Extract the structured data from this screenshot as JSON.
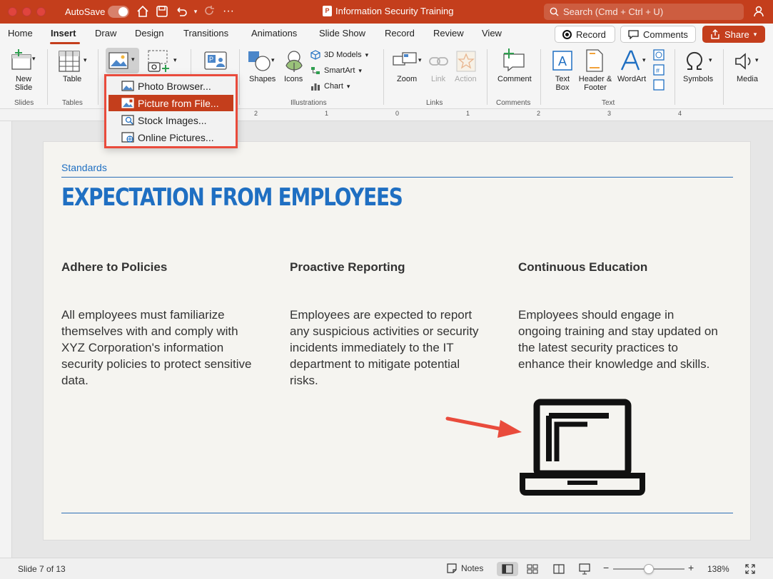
{
  "window": {
    "autosave_label": "AutoSave",
    "title": "Information Security Training",
    "search_placeholder": "Search (Cmd + Ctrl + U)"
  },
  "tabs": [
    "Home",
    "Insert",
    "Draw",
    "Design",
    "Transitions",
    "Animations",
    "Slide Show",
    "Record",
    "Review",
    "View"
  ],
  "tab_actions": {
    "record": "Record",
    "comments": "Comments",
    "share": "Share"
  },
  "ribbon": {
    "new_slide": [
      "New",
      "Slide"
    ],
    "table": "Table",
    "shapes": "Shapes",
    "icons": "Icons",
    "models_3d": "3D Models",
    "smartart": "SmartArt",
    "chart": "Chart",
    "zoom": "Zoom",
    "link": "Link",
    "action": "Action",
    "comment": "Comment",
    "text_box": [
      "Text",
      "Box"
    ],
    "header_footer": [
      "Header &",
      "Footer"
    ],
    "wordart": "WordArt",
    "symbols": "Symbols",
    "media": "Media",
    "groups": [
      "Slides",
      "Tables",
      "Illustrations",
      "Links",
      "Comments",
      "Text"
    ]
  },
  "picture_menu": [
    {
      "label": "Photo Browser...",
      "icon": "photo-browser-icon",
      "highlighted": false
    },
    {
      "label": "Picture from File...",
      "icon": "picture-from-file-icon",
      "highlighted": true
    },
    {
      "label": "Stock Images...",
      "icon": "stock-images-icon",
      "highlighted": false
    },
    {
      "label": "Online Pictures...",
      "icon": "online-pictures-icon",
      "highlighted": false
    }
  ],
  "ruler": {
    "ticks": [
      "3",
      "2",
      "1",
      "0",
      "1",
      "2",
      "3",
      "4"
    ]
  },
  "slide": {
    "eyebrow": "Standards",
    "title": "EXPECTATION FROM EMPLOYEES",
    "columns": [
      {
        "heading": "Adhere to Policies",
        "body": "All employees must familiarize themselves with and comply with XYZ Corporation's information security policies to protect sensitive data."
      },
      {
        "heading": "Proactive Reporting",
        "body": "Employees are expected to report any suspicious activities or security incidents immediately to the IT department to mitigate potential risks."
      },
      {
        "heading": "Continuous Education",
        "body": "Employees should engage in ongoing training and stay updated on the latest security practices to enhance their knowledge and skills."
      }
    ]
  },
  "status": {
    "slide_counter": "Slide 7 of 13",
    "notes": "Notes",
    "zoom_percent": "138%",
    "zoom_level": 0.5
  },
  "colors": {
    "accent": "#c43e1c",
    "slide_blue": "#1f6fc2",
    "annotation_red": "#e94b3c"
  }
}
